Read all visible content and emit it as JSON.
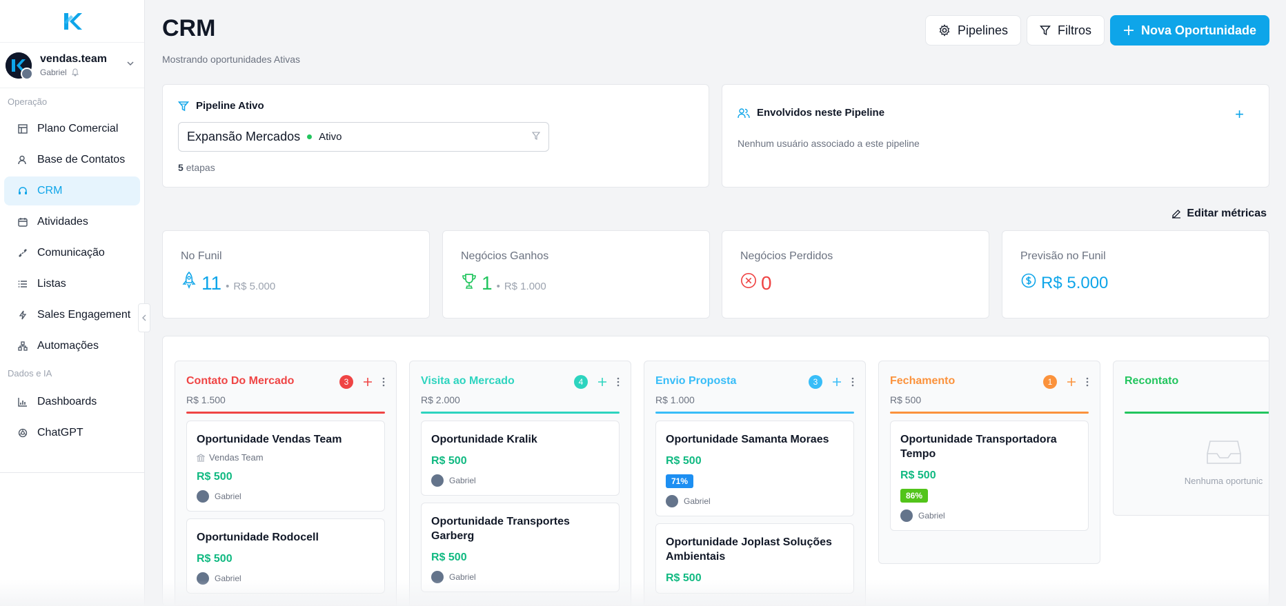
{
  "sidebar": {
    "team_name": "vendas.team",
    "user_name": "Gabriel",
    "section_operacao": "Operação",
    "section_dados": "Dados e IA",
    "items": [
      {
        "label": "Plano Comercial",
        "icon": "layout-icon"
      },
      {
        "label": "Base de Contatos",
        "icon": "contacts-icon"
      },
      {
        "label": "CRM",
        "icon": "headset-icon"
      },
      {
        "label": "Atividades",
        "icon": "calendar-icon"
      },
      {
        "label": "Comunicação",
        "icon": "link-icon"
      },
      {
        "label": "Listas",
        "icon": "list-icon"
      },
      {
        "label": "Sales Engagement",
        "icon": "bolt-icon"
      },
      {
        "label": "Automações",
        "icon": "workflow-icon"
      }
    ],
    "data_items": [
      {
        "label": "Dashboards",
        "icon": "bar-chart-icon"
      },
      {
        "label": "ChatGPT",
        "icon": "openai-icon"
      }
    ]
  },
  "header": {
    "title": "CRM",
    "subtitle": "Mostrando oportunidades Ativas",
    "pipelines_label": "Pipelines",
    "filters_label": "Filtros",
    "new_opportunity_label": "Nova Oportunidade"
  },
  "pipeline": {
    "title": "Pipeline Ativo",
    "selected": "Expansão Mercados",
    "status": "Ativo",
    "steps_count": "5",
    "steps_label": "etapas"
  },
  "people": {
    "title": "Envolvidos neste Pipeline",
    "empty": "Nenhum usuário associado a este pipeline",
    "add": "+"
  },
  "edit_metrics_label": "Editar métricas",
  "metrics": {
    "funnel": {
      "label": "No Funil",
      "value": "11",
      "amount": "R$ 5.000"
    },
    "won": {
      "label": "Negócios Ganhos",
      "value": "1",
      "amount": "R$ 1.000"
    },
    "lost": {
      "label": "Negócios Perdidos",
      "value": "0"
    },
    "forecast": {
      "label": "Previsão no Funil",
      "value": "R$ 5.000"
    }
  },
  "colors": {
    "accent": "#0ea5e9",
    "col1": "#ef4444",
    "col2": "#2dd4bf",
    "col3": "#38bdf8",
    "col4": "#fb923c",
    "col5": "#22c55e",
    "value_green": "#10b981",
    "badge_blue": "#1d8ff2",
    "badge_green": "#52c41a"
  },
  "board": {
    "separator": "•",
    "columns": [
      {
        "title": "Contato Do Mercado",
        "count": "3",
        "total": "R$ 1.500",
        "deals": [
          {
            "title": "Oportunidade Vendas Team",
            "company": "Vendas Team",
            "value": "R$ 500",
            "owner": "Gabriel"
          },
          {
            "title": "Oportunidade Rodocell",
            "value": "R$ 500",
            "owner": "Gabriel"
          }
        ]
      },
      {
        "title": "Visita ao Mercado",
        "count": "4",
        "total": "R$ 2.000",
        "deals": [
          {
            "title": "Oportunidade Kralik",
            "value": "R$ 500",
            "owner": "Gabriel"
          },
          {
            "title": "Oportunidade Transportes Garberg",
            "value": "R$ 500",
            "owner": "Gabriel"
          }
        ]
      },
      {
        "title": "Envio Proposta",
        "count": "3",
        "total": "R$ 1.000",
        "deals": [
          {
            "title": "Oportunidade Samanta Moraes",
            "value": "R$ 500",
            "badge": "71%",
            "owner": "Gabriel"
          },
          {
            "title": "Oportunidade Joplast Soluções Ambientais",
            "value": "R$ 500"
          }
        ]
      },
      {
        "title": "Fechamento",
        "count": "1",
        "total": "R$ 500",
        "deals": [
          {
            "title": "Oportunidade Transportadora Tempo",
            "value": "R$ 500",
            "badge": "86%",
            "owner": "Gabriel"
          }
        ]
      },
      {
        "title": "Recontato",
        "empty": "Nenhuma oportunic"
      }
    ]
  }
}
